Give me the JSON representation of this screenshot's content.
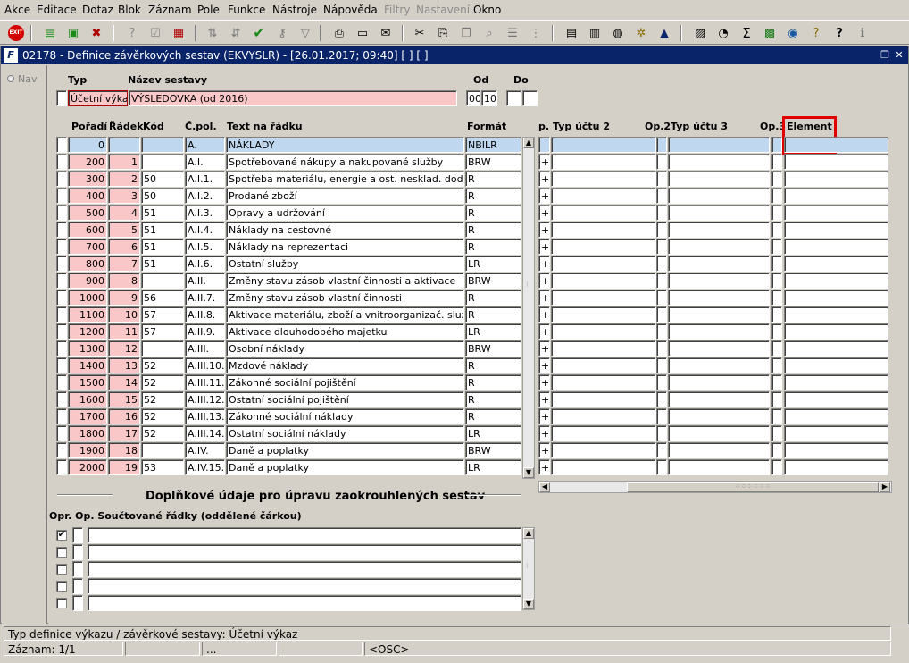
{
  "menu": [
    "Akce",
    "Editace",
    "Dotaz",
    "Blok",
    "Záznam",
    "Pole",
    "Funkce",
    "Nástroje",
    "Nápověda",
    "Filtry",
    "Nastavení",
    "Okno"
  ],
  "window_title": "02178 - Definice závěrkových sestav (EKVYSLR) - [26.01.2017; 09:40]  [ ]  [ ]",
  "nav_label": "Nav",
  "header": {
    "typ_label": "Typ",
    "nazev_label": "Název sestavy",
    "od_label": "Od",
    "do_label": "Do",
    "typ_value": "Účetní výkaz",
    "nazev_value": "VÝSLEDOVKA (od 2016)",
    "od_value1": "00",
    "od_value2": "10",
    "do_value1": "",
    "do_value2": ""
  },
  "columns": {
    "poradi": "Pořadí",
    "radek": "Řádek",
    "kod": "Kód",
    "cpol": "Č.pol.",
    "text": "Text na řádku",
    "format": "Formát",
    "op": "p.",
    "typ2": "Typ účtu 2",
    "op2": "Op.2",
    "typ3": "Typ účtu 3",
    "op3": "Op.3",
    "element": "Element"
  },
  "rows": [
    {
      "poradi": "0",
      "radek": "",
      "kod": "",
      "cpol": "A.",
      "text": "NÁKLADY",
      "format": "NBILR",
      "op": ""
    },
    {
      "poradi": "200",
      "radek": "1",
      "kod": "",
      "cpol": "A.I.",
      "text": "Spotřebované nákupy a nakupované služby",
      "format": "BRW",
      "op": "+"
    },
    {
      "poradi": "300",
      "radek": "2",
      "kod": "50",
      "cpol": "A.I.1.",
      "text": "Spotřeba materiálu, energie a ost. nesklad. dodávek",
      "format": "R",
      "op": "+"
    },
    {
      "poradi": "400",
      "radek": "3",
      "kod": "50",
      "cpol": "A.I.2.",
      "text": "Prodané zboží",
      "format": "R",
      "op": "+"
    },
    {
      "poradi": "500",
      "radek": "4",
      "kod": "51",
      "cpol": "A.I.3.",
      "text": "Opravy a udržování",
      "format": "R",
      "op": "+"
    },
    {
      "poradi": "600",
      "radek": "5",
      "kod": "51",
      "cpol": "A.I.4.",
      "text": "Náklady na cestovné",
      "format": "R",
      "op": "+"
    },
    {
      "poradi": "700",
      "radek": "6",
      "kod": "51",
      "cpol": "A.I.5.",
      "text": "Náklady na reprezentaci",
      "format": "R",
      "op": "+"
    },
    {
      "poradi": "800",
      "radek": "7",
      "kod": "51",
      "cpol": "A.I.6.",
      "text": "Ostatní služby",
      "format": "LR",
      "op": "+"
    },
    {
      "poradi": "900",
      "radek": "8",
      "kod": "",
      "cpol": "A.II.",
      "text": "Změny stavu zásob vlastní činnosti a aktivace",
      "format": "BRW",
      "op": "+"
    },
    {
      "poradi": "1000",
      "radek": "9",
      "kod": "56",
      "cpol": "A.II.7.",
      "text": "Změny stavu zásob vlastní činnosti",
      "format": "R",
      "op": "+"
    },
    {
      "poradi": "1100",
      "radek": "10",
      "kod": "57",
      "cpol": "A.II.8.",
      "text": "Aktivace materiálu, zboží a vnitroorganizač. služeb",
      "format": "R",
      "op": "+"
    },
    {
      "poradi": "1200",
      "radek": "11",
      "kod": "57",
      "cpol": "A.II.9.",
      "text": "Aktivace dlouhodobého majetku",
      "format": "LR",
      "op": "+"
    },
    {
      "poradi": "1300",
      "radek": "12",
      "kod": "",
      "cpol": "A.III.",
      "text": "Osobní náklady",
      "format": "BRW",
      "op": "+"
    },
    {
      "poradi": "1400",
      "radek": "13",
      "kod": "52",
      "cpol": "A.III.10.",
      "text": "Mzdové náklady",
      "format": "R",
      "op": "+"
    },
    {
      "poradi": "1500",
      "radek": "14",
      "kod": "52",
      "cpol": "A.III.11.",
      "text": "Zákonné sociální pojištění",
      "format": "R",
      "op": "+"
    },
    {
      "poradi": "1600",
      "radek": "15",
      "kod": "52",
      "cpol": "A.III.12.",
      "text": "Ostatní sociální pojištění",
      "format": "R",
      "op": "+"
    },
    {
      "poradi": "1700",
      "radek": "16",
      "kod": "52",
      "cpol": "A.III.13.",
      "text": "Zákonné sociální náklady",
      "format": "R",
      "op": "+"
    },
    {
      "poradi": "1800",
      "radek": "17",
      "kod": "52",
      "cpol": "A.III.14.",
      "text": "Ostatní sociální náklady",
      "format": "LR",
      "op": "+"
    },
    {
      "poradi": "1900",
      "radek": "18",
      "kod": "",
      "cpol": "A.IV.",
      "text": "Daně a poplatky",
      "format": "BRW",
      "op": "+"
    },
    {
      "poradi": "2000",
      "radek": "19",
      "kod": "53",
      "cpol": "A.IV.15.",
      "text": "Daně a poplatky",
      "format": "LR",
      "op": "+"
    }
  ],
  "section_title": "Doplňkové údaje pro úpravu zaokrouhlených sestav",
  "lower_header": "Opr. Op.  Součtované řádky (oddělené čárkou)",
  "lower_rows": [
    {
      "checked": true,
      "op": "",
      "value": ""
    },
    {
      "checked": false,
      "op": "",
      "value": ""
    },
    {
      "checked": false,
      "op": "",
      "value": ""
    },
    {
      "checked": false,
      "op": "",
      "value": ""
    },
    {
      "checked": false,
      "op": "",
      "value": ""
    }
  ],
  "status": {
    "hint": "Typ definice výkazu / závěrkové sestavy: Účetní výkaz",
    "record": "Záznam: 1/1",
    "seg3": "...",
    "osc": "<OSC>"
  },
  "colors": {
    "title_bg": "#0a246a",
    "pink": "#f9c7c7",
    "selected": "#bfd8f0",
    "highlight_box": "#e00000"
  }
}
